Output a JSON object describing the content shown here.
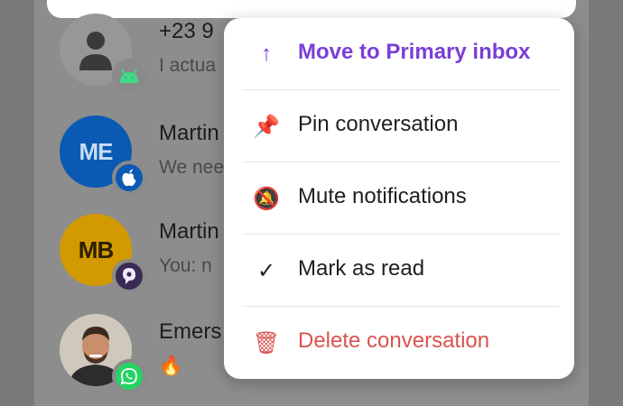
{
  "conversations": [
    {
      "name": "+23 9",
      "preview": "I actua",
      "avatar_initials": "",
      "avatar_color": "#979797",
      "badge": "android-icon",
      "badge_color": "#3ddc84"
    },
    {
      "name": "Martin",
      "preview": "We nee",
      "avatar_initials": "ME",
      "avatar_color": "#0a5ab4",
      "initials_color": "#c9dcf3",
      "badge": "apple-icon",
      "badge_color": "#0a5ab4"
    },
    {
      "name": "Martin",
      "preview": "You: n",
      "avatar_initials": "MB",
      "avatar_color": "#d29a00",
      "initials_color": "#2a2000",
      "badge": "beeper-icon",
      "badge_color": "#3a2a55"
    },
    {
      "name": "Emers",
      "preview": "🔥",
      "avatar_initials": "",
      "avatar_color": "#d8d0c4",
      "badge": "whatsapp-icon",
      "badge_color": "#25d366"
    }
  ],
  "context_menu": {
    "items": [
      {
        "label": "Move to Primary inbox",
        "icon": "arrow-up-icon",
        "glyph": "↑",
        "color": "#7a3fd6",
        "bold": true
      },
      {
        "label": "Pin conversation",
        "icon": "pin-icon",
        "glyph": "📌",
        "color": "#1f1f1f",
        "bold": false
      },
      {
        "label": "Mute notifications",
        "icon": "bell-muted-icon",
        "glyph": "🔕",
        "color": "#1f1f1f",
        "bold": false
      },
      {
        "label": "Mark as read",
        "icon": "checkmark-icon",
        "glyph": "✓",
        "color": "#1f1f1f",
        "bold": false
      },
      {
        "label": "Delete conversation",
        "icon": "trash-icon",
        "glyph": "🗑",
        "color": "#d9534f",
        "bold": false
      }
    ]
  }
}
